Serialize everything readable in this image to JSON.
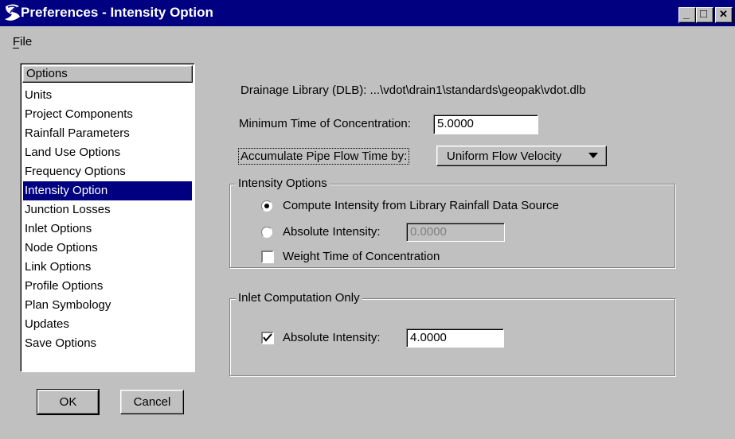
{
  "window": {
    "title": "Preferences - Intensity Option",
    "minimize_glyph": "_",
    "maximize_glyph": "□",
    "close_glyph": "✕"
  },
  "menu": {
    "file": "File"
  },
  "options": {
    "header": "Options",
    "items": [
      "Units",
      "Project Components",
      "Rainfall Parameters",
      "Land Use Options",
      "Frequency Options",
      "Intensity Option",
      "Junction Losses",
      "Inlet Options",
      "Node Options",
      "Link Options",
      "Profile Options",
      "Plan Symbology",
      "Updates",
      "Save Options"
    ],
    "selected": "Intensity Option"
  },
  "buttons": {
    "ok": "OK",
    "cancel": "Cancel"
  },
  "main": {
    "drainage_library": "Drainage Library (DLB): ...\\vdot\\drain1\\standards\\geopak\\vdot.dlb",
    "min_toc_label": "Minimum Time of Concentration:",
    "min_toc_value": "5.0000",
    "accumulate_label": "Accumulate Pipe Flow Time by:",
    "accumulate_value": "Uniform Flow Velocity",
    "intensity_group": {
      "title": "Intensity Options",
      "radio_library": "Compute Intensity from Library Rainfall Data Source",
      "radio_library_selected": true,
      "radio_absolute": "Absolute Intensity:",
      "absolute_value": "0.0000",
      "weight_toc": "Weight Time of Concentration",
      "weight_toc_checked": false
    },
    "inlet_group": {
      "title": "Inlet Computation Only",
      "absolute_label": "Absolute Intensity:",
      "absolute_checked": true,
      "absolute_value": "4.0000"
    }
  }
}
